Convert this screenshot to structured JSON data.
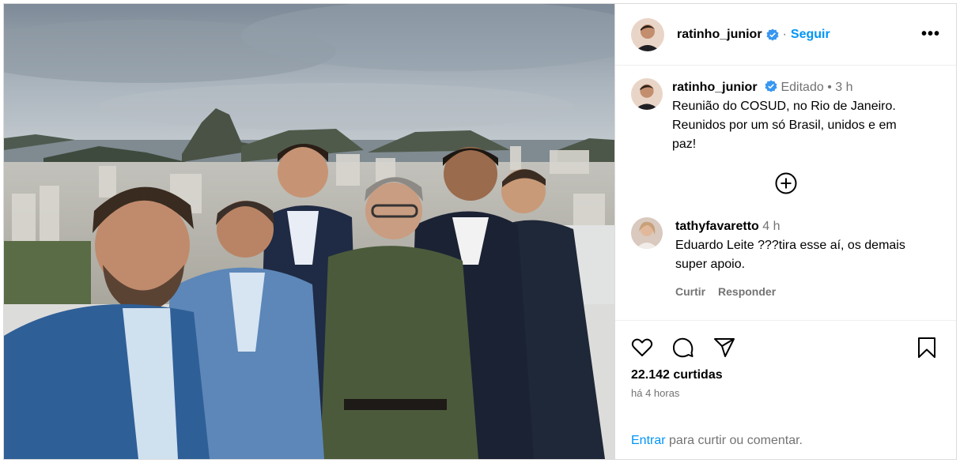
{
  "post": {
    "author": "ratinho_junior",
    "follow_label": "Seguir",
    "more_label": "•••",
    "separator": "·"
  },
  "caption": {
    "author": "ratinho_junior",
    "edited": "Editado",
    "dot": "•",
    "time": "3 h",
    "text_line1": "Reunião do COSUD, no Rio de Janeiro.",
    "text_line2": "Reunidos por um só Brasil, unidos e em",
    "text_line3": "paz!"
  },
  "comment": {
    "author": "tathyfavaretto",
    "time": "4 h",
    "text_line1": "Eduardo Leite ???tira esse aí, os demais",
    "text_line2": "super apoio.",
    "like_label": "Curtir",
    "reply_label": "Responder"
  },
  "stats": {
    "likes": "22.142 curtidas",
    "posted": "há 4 horas"
  },
  "footer": {
    "login_link": "Entrar",
    "login_rest": " para curtir ou comentar."
  },
  "icons": {
    "verified": "verified-badge-icon",
    "more": "more-options-icon",
    "load_more": "plus-circle-icon",
    "like": "heart-icon",
    "comment": "comment-bubble-icon",
    "share": "paper-plane-icon",
    "save": "bookmark-icon"
  },
  "colors": {
    "link_blue": "#0095f6",
    "muted_gray": "#737373",
    "border": "#dbdbdb",
    "verified_blue": "#3897f0"
  }
}
